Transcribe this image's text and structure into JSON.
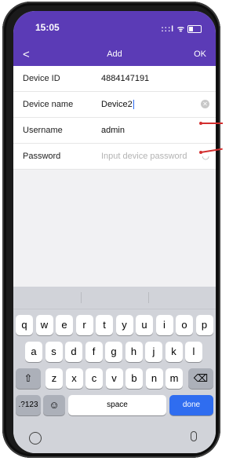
{
  "status": {
    "time": "15:05",
    "signal": ":::l ᯤ"
  },
  "nav": {
    "back_glyph": "<",
    "title": "Add",
    "ok": "OK"
  },
  "form": {
    "device_id": {
      "label": "Device ID",
      "value": "4884147191"
    },
    "device_name": {
      "label": "Device name",
      "value": "Device2"
    },
    "username": {
      "label": "Username",
      "value": "admin"
    },
    "password": {
      "label": "Password",
      "placeholder": "Input device password"
    }
  },
  "keyboard": {
    "row1": [
      "q",
      "w",
      "e",
      "r",
      "t",
      "y",
      "u",
      "i",
      "o",
      "p"
    ],
    "row2": [
      "a",
      "s",
      "d",
      "f",
      "g",
      "h",
      "j",
      "k",
      "l"
    ],
    "row3": [
      "z",
      "x",
      "c",
      "v",
      "b",
      "n",
      "m"
    ],
    "shift": "⇧",
    "backspace": "⌫",
    "numbers": ".?123",
    "emoji": "☺",
    "space": "space",
    "done": "done"
  },
  "accent_color": "#5b3bb6"
}
